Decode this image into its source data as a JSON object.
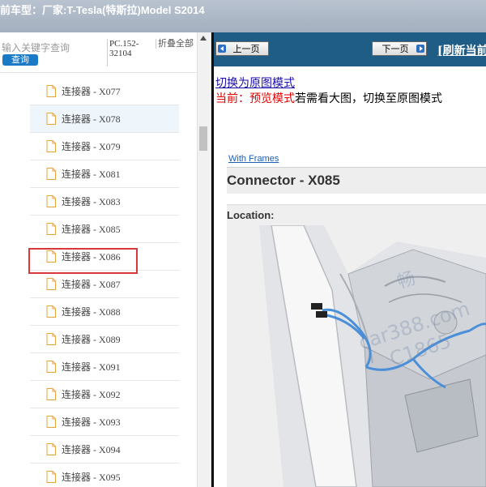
{
  "window": {
    "title": "前车型：厂家:T-Tesla(特斯拉)Model S2014"
  },
  "sidebar": {
    "search_placeholder": "输入关键字查询",
    "search_button": "查询",
    "pc_code": "PC.152-32104",
    "collapse_all": "折叠全部",
    "items": [
      {
        "label": "连接器 - X077"
      },
      {
        "label": "连接器 - X078"
      },
      {
        "label": "连接器 - X079"
      },
      {
        "label": "连接器 - X081"
      },
      {
        "label": "连接器 - X083"
      },
      {
        "label": "连接器 - X085"
      },
      {
        "label": "连接器 - X086"
      },
      {
        "label": "连接器 - X087"
      },
      {
        "label": "连接器 - X088"
      },
      {
        "label": "连接器 - X089"
      },
      {
        "label": "连接器 - X091"
      },
      {
        "label": "连接器 - X092"
      },
      {
        "label": "连接器 - X093"
      },
      {
        "label": "连接器 - X094"
      },
      {
        "label": "连接器 - X095"
      }
    ],
    "selected_item": "连接器 - X085",
    "hovered_item": "连接器 - X078"
  },
  "viewer": {
    "prev_button": "上一页",
    "next_button": "下一页",
    "refresh_link": "[刷新当前",
    "switch_link": "切换为原图模式",
    "mode_current_label": "当前：预览模式",
    "mode_hint": "若需看大图，切换至原图模式",
    "with_frames": "With Frames",
    "connector_title": "Connector - X085",
    "location_label": "Location:",
    "watermark_1": "畅",
    "watermark_2": "car388.com",
    "watermark_3": "C1865"
  },
  "colors": {
    "navbar": "#1f5d86",
    "highlight": "#d9383a",
    "search_button": "#1b7ac6",
    "mode_red": "#e00000",
    "link": "#1a0dab",
    "wire": "#4a8fd8"
  },
  "icons": {
    "tree_item": "document-icon",
    "prev": "left-arrow-icon",
    "next": "right-arrow-icon",
    "scroll_up": "scroll-up-arrow-icon"
  }
}
